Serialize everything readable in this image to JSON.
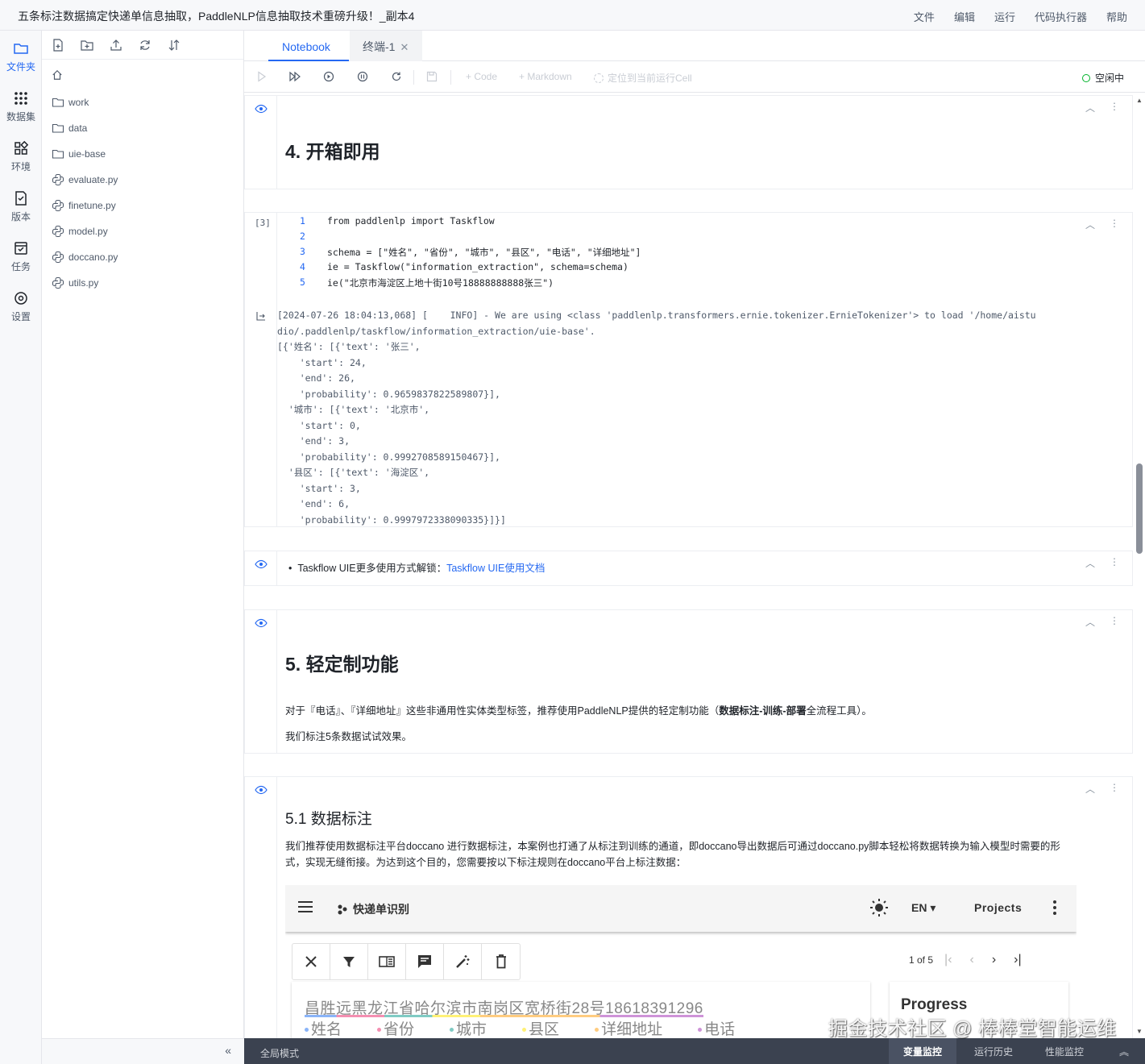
{
  "window": {
    "title": "五条标注数据搞定快递单信息抽取，PaddleNLP信息抽取技术重磅升级！_副本4",
    "menu": [
      "文件",
      "编辑",
      "运行",
      "代码执行器",
      "帮助"
    ]
  },
  "activity": [
    {
      "label": "文件夹",
      "icon": "folder-icon"
    },
    {
      "label": "数据集",
      "icon": "dataset-icon"
    },
    {
      "label": "环境",
      "icon": "environment-icon"
    },
    {
      "label": "版本",
      "icon": "version-icon"
    },
    {
      "label": "任务",
      "icon": "task-icon"
    },
    {
      "label": "设置",
      "icon": "settings-icon"
    }
  ],
  "files": [
    {
      "name": "work",
      "type": "folder"
    },
    {
      "name": "data",
      "type": "folder"
    },
    {
      "name": "uie-base",
      "type": "folder"
    },
    {
      "name": "evaluate.py",
      "type": "python"
    },
    {
      "name": "finetune.py",
      "type": "python"
    },
    {
      "name": "model.py",
      "type": "python"
    },
    {
      "name": "doccano.py",
      "type": "python"
    },
    {
      "name": "utils.py",
      "type": "python"
    }
  ],
  "tabs": [
    {
      "label": "Notebook",
      "active": true
    },
    {
      "label": "终端-1",
      "active": false
    }
  ],
  "toolbar": {
    "add_code": "+ Code",
    "add_markdown": "+ Markdown",
    "locate": "定位到当前运行Cell",
    "kernel_status": "空闲中"
  },
  "cells": {
    "h_open": "4. 开箱即用",
    "code_prompt": "[3]",
    "code_lines": [
      {
        "n": "1",
        "text": "from paddlenlp import Taskflow"
      },
      {
        "n": "2",
        "text": ""
      },
      {
        "n": "3",
        "text": "schema = [\"姓名\", \"省份\", \"城市\", \"县区\", \"电话\", \"详细地址\"]"
      },
      {
        "n": "4",
        "text": "ie = Taskflow(\"information_extraction\", schema=schema)"
      },
      {
        "n": "5",
        "text": "ie(\"北京市海淀区上地十街10号18888888888张三\")"
      }
    ],
    "output_lines": [
      "[2024-07-26 18:04:13,068] [    INFO] - We are using <class 'paddlenlp.transformers.ernie.tokenizer.ErnieTokenizer'> to load '/home/aistu",
      "dio/.paddlenlp/taskflow/information_extraction/uie-base'.",
      "[{'姓名': [{'text': '张三',",
      "    'start': 24,",
      "    'end': 26,",
      "    'probability': 0.9659837822589807}],",
      "  '城市': [{'text': '北京市',",
      "    'start': 0,",
      "    'end': 3,",
      "    'probability': 0.9992708589150467}],",
      "  '县区': [{'text': '海淀区',",
      "    'start': 3,",
      "    'end': 6,",
      "    'probability': 0.9997972338090335}]}]"
    ],
    "bullet_text": "Taskflow UIE更多使用方式解锁：",
    "bullet_link": "Taskflow UIE使用文档",
    "h_custom": "5. 轻定制功能",
    "custom_p1_a": "对于『电话』、『详细地址』这些非通用性实体类型标签，推荐使用PaddleNLP提供的轻定制功能（",
    "custom_p1_b": "数据标注-训练-部署",
    "custom_p1_c": "全流程工具）。",
    "custom_p2": "我们标注5条数据试试效果。",
    "h_label": "5.1 数据标注",
    "label_p": "我们推荐使用数据标注平台doccano 进行数据标注，本案例也打通了从标注到训练的通道，即doccano导出数据后可通过doccano.py脚本轻松将数据转换为输入模型时需要的形式，实现无缝衔接。为达到这个目的，您需要按以下标注规则在doccano平台上标注数据："
  },
  "doccano": {
    "project": "快递单识别",
    "lang": "EN",
    "projects": "Projects",
    "pager": "1 of 5",
    "sample_text": "昌胜远黑龙江省哈尔滨市南岗区宽桥街28号18618391296",
    "labels": [
      "姓名",
      "省份",
      "城市",
      "县区",
      "详细地址",
      "电话"
    ],
    "label_colors": [
      "#8ab4f8",
      "#f48fb1",
      "#80cbc4",
      "#fff176",
      "#ffcc80",
      "#ce93d8"
    ],
    "progress": "Progress"
  },
  "bottom": {
    "global_mode": "全局模式",
    "tabs": [
      "变量监控",
      "运行历史",
      "性能监控"
    ]
  },
  "watermark": "掘金技术社区 @ 棒棒堂智能运维"
}
